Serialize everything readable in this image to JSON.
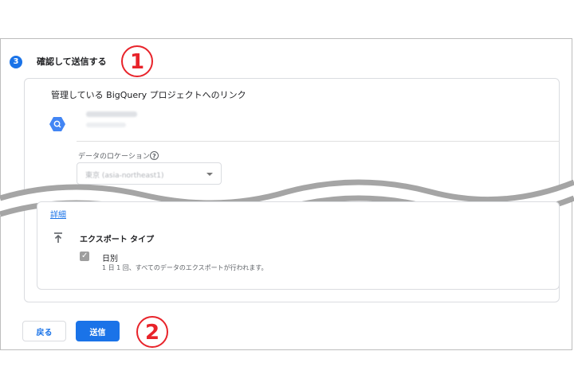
{
  "step": {
    "number": "3",
    "title": "確認して送信する"
  },
  "annotations": {
    "first": "1",
    "second": "2"
  },
  "link": {
    "heading": "管理している BigQuery プロジェクトへのリンク",
    "project_icon": "bigquery-icon"
  },
  "location": {
    "label": "データのロケーション",
    "help_icon": "?",
    "selected_value": "東京 (asia-northeast1)"
  },
  "details": {
    "link_label": "詳細"
  },
  "export": {
    "icon": "upload-icon",
    "title": "エクスポート タイプ",
    "daily": {
      "label": "日別",
      "description": "1 日 1 回、すべてのデータのエクスポートが行われます。",
      "checked": true
    }
  },
  "actions": {
    "back_label": "戻る",
    "submit_label": "送信"
  },
  "colors": {
    "accent": "#1a73e8",
    "annotation": "#e8232a",
    "checkbox_disabled": "#9e9e9e"
  }
}
